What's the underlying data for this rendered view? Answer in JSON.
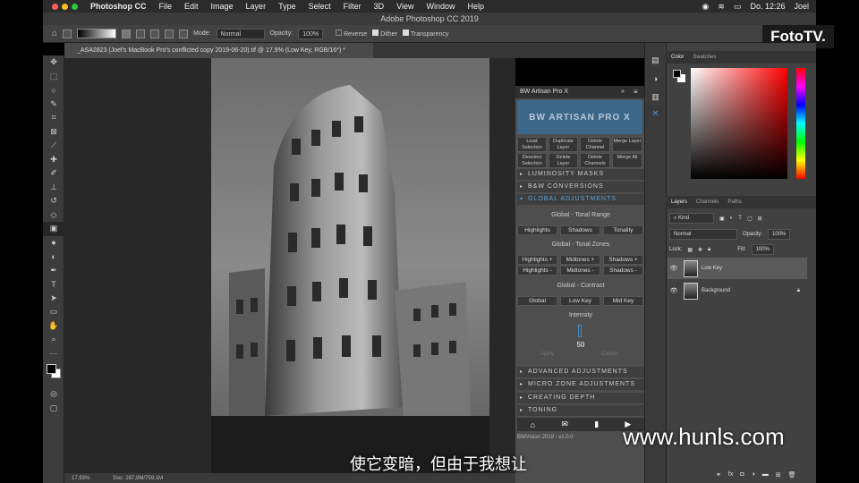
{
  "menubar": {
    "app": "Photoshop CC",
    "items": [
      "File",
      "Edit",
      "Image",
      "Layer",
      "Type",
      "Select",
      "Filter",
      "3D",
      "View",
      "Window",
      "Help"
    ],
    "clock": "Do. 12:26",
    "user": "Joel"
  },
  "window_title": "Adobe Photoshop CC 2019",
  "options": {
    "mode_label": "Mode:",
    "mode_value": "Normal",
    "opacity_label": "Opacity:",
    "opacity_value": "100%",
    "reverse": "Reverse",
    "dither": "Dither",
    "transparency": "Transparency"
  },
  "brand_badge": "FotoTV.",
  "document_tab": "_ASA2823 (Joel's MacBook Pro's conflicted copy 2019-06-20).tif @ 17,9% (Low Key, RGB/16*) *",
  "status": {
    "zoom": "17,93%",
    "doc": "Doc: 287,9M/759,1M"
  },
  "bw_panel": {
    "title": "BW Artisan Pro X",
    "logo": "BW ARTISAN PRO X",
    "buttons_row1": [
      "Load Selection",
      "Duplicate Layer",
      "Delete Channel",
      "Merge Layer"
    ],
    "buttons_row2": [
      "Deselect Selection",
      "Delete Layer",
      "Delete Channels",
      "Merge All"
    ],
    "sections_top": [
      "LUMINOSITY MASKS",
      "B&W CONVERSIONS",
      "GLOBAL ADJUSTMENTS"
    ],
    "tonal_range_title": "Global - Tonal Range",
    "tonal_range": [
      "Highlights",
      "Shadows",
      "Tonality"
    ],
    "tonal_zones_title": "Global - Tonal Zones",
    "tonal_zones_row1": [
      "Highlights +",
      "Midtones +",
      "Shadows +"
    ],
    "tonal_zones_row2": [
      "Highlights -",
      "Midtones -",
      "Shadows -"
    ],
    "contrast_title": "Global - Contrast",
    "contrast": [
      "Global",
      "Low Key",
      "Mid Key"
    ],
    "intensity_label": "Intensity",
    "intensity_value": "50",
    "apply": "Apply",
    "cancel": "Cancel",
    "sections_bottom": [
      "ADVANCED ADJUSTMENTS",
      "MICRO ZONE ADJUSTMENTS",
      "CREATING DEPTH",
      "TONING"
    ],
    "footer": "BWVision 2019 - v1.0.0"
  },
  "color_panel": {
    "tabs": [
      "Color",
      "Swatches"
    ]
  },
  "layers_panel": {
    "tabs": [
      "Layers",
      "Channels",
      "Paths"
    ],
    "filter": "Kind",
    "blend": "Normal",
    "opacity_label": "Opacity:",
    "opacity_value": "100%",
    "lock_label": "Lock:",
    "fill_label": "Fill:",
    "fill_value": "100%",
    "layers": [
      "Low Key",
      "Background"
    ]
  },
  "watermark": "www.hunls.com",
  "subtitle": "使它变暗，但由于我想让"
}
